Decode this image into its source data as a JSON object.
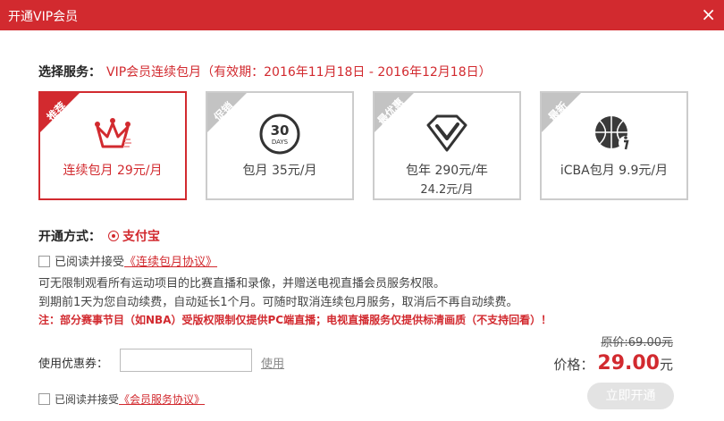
{
  "window": {
    "title": "开通VIP会员",
    "close_label": "×"
  },
  "service": {
    "label": "选择服务：",
    "value": "VIP会员连续包月（有效期：2016年11月18日 - 2016年12月18日）"
  },
  "plans": [
    {
      "tag": "推荐",
      "name": "连续包月 29元/月",
      "sub": "",
      "icon": "crown-icon"
    },
    {
      "tag": "促销",
      "name": "包月 35元/月",
      "sub": "",
      "icon": "30-days-icon",
      "icon_text_top": "30",
      "icon_text_bottom": "DAYS"
    },
    {
      "tag": "最优惠",
      "name": "包年 290元/年",
      "sub": "24.2元/月",
      "icon": "diamond-v-icon"
    },
    {
      "tag": "最新",
      "name": "iCBA包月 9.9元/月",
      "sub": "",
      "icon": "basketball-icon"
    }
  ],
  "payment": {
    "label": "开通方式：",
    "method": "支付宝"
  },
  "agreement1": {
    "text": "已阅读并接受",
    "link": "《连续包月协议》"
  },
  "description": [
    "可无限制观看所有运动项目的比赛直播和录像，并赠送电视直播会员服务权限。",
    "到期前1天为您自动续费，自动延长1个月。可随时取消连续包月服务，取消后不再自动续费。"
  ],
  "warning": "注：部分赛事节目（如NBA）受版权限制仅提供PC端直播；电视直播服务仅提供标清画质（不支持回看）！",
  "coupon": {
    "label": "使用优惠券：",
    "placeholder": "",
    "action": "使用"
  },
  "price": {
    "original_label": "原价:",
    "original_value": "69.00元",
    "label": "价格：",
    "value": "29.00",
    "unit": "元"
  },
  "agreement2": {
    "text": "已阅读并接受",
    "link": "《会员服务协议》"
  },
  "submit_label": "立即开通",
  "colors": {
    "accent": "#d22a2f",
    "inactive_corner": "#c3c3c3",
    "disabled_button": "#e3e3e3"
  }
}
